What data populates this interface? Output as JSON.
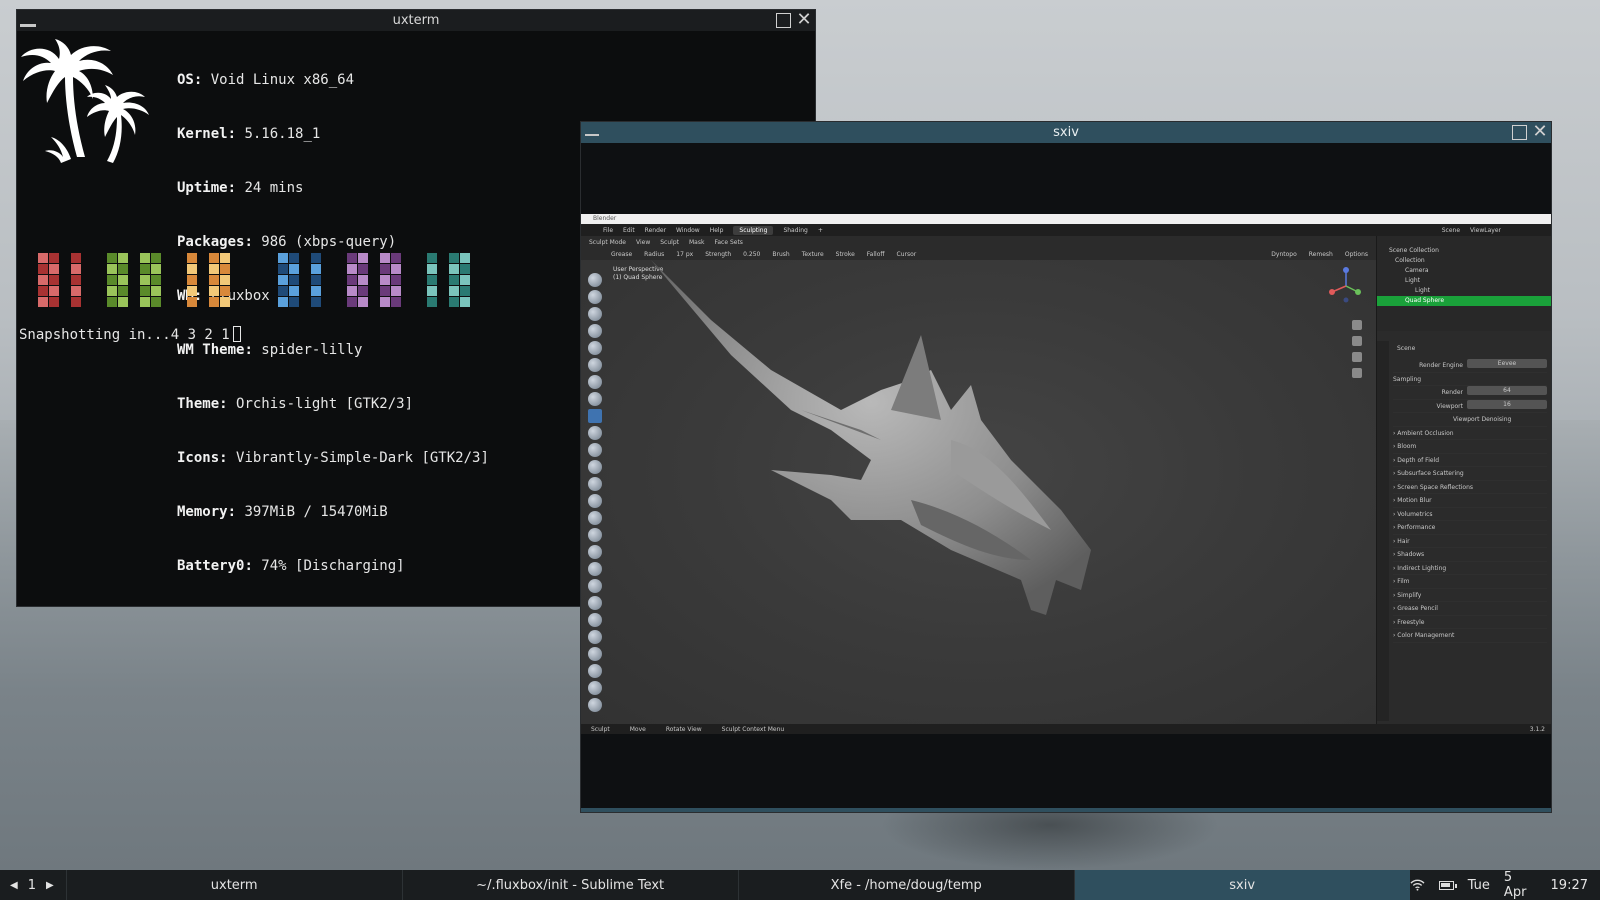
{
  "colors": {
    "accent_teal": "#2f4f5e",
    "terminal_bg": "#0c0d0e",
    "outliner_selected": "#1aa13a"
  },
  "uxterm": {
    "title": "uxterm",
    "info": [
      {
        "key": "OS",
        "value": "Void Linux x86_64"
      },
      {
        "key": "Kernel",
        "value": "5.16.18_1"
      },
      {
        "key": "Uptime",
        "value": "24 mins"
      },
      {
        "key": "Packages",
        "value": "986 (xbps-query)"
      },
      {
        "key": "WM",
        "value": "Fluxbox"
      },
      {
        "key": "WM Theme",
        "value": "spider-lilly"
      },
      {
        "key": "Theme",
        "value": "Orchis-light [GTK2/3]"
      },
      {
        "key": "Icons",
        "value": "Vibrantly-Simple-Dark [GTK2/3]"
      },
      {
        "key": "Memory",
        "value": "397MiB / 15470MiB"
      },
      {
        "key": "Battery0",
        "value": "74% [Discharging]"
      }
    ],
    "swatch_colors": [
      [
        "#a83232",
        "#d86a6a"
      ],
      [
        "#5a8a2a",
        "#9ac45a"
      ],
      [
        "#d8883a",
        "#f2c878"
      ],
      [
        "#1f4a78",
        "#5aa0dc"
      ],
      [
        "#6a3a7a",
        "#b88ac8"
      ],
      [
        "#2a7a72",
        "#7ac4bc"
      ]
    ],
    "prompt": "Snapshotting in...4 3 2 1"
  },
  "sxiv": {
    "title": "sxiv",
    "blender": {
      "os_title": "Blender",
      "menu": [
        "File",
        "Edit",
        "Render",
        "Window",
        "Help"
      ],
      "workspace_tabs": [
        "Sculpting",
        "Shading",
        "+"
      ],
      "scene": "Scene",
      "view_layer": "ViewLayer",
      "header": [
        "Sculpt Mode",
        "View",
        "Sculpt",
        "Mask",
        "Face Sets"
      ],
      "tool_settings": [
        "Radius",
        "17 px",
        "Strength",
        "0.250",
        "Brush",
        "Texture",
        "Stroke",
        "Falloff",
        "Cursor"
      ],
      "brush_name": "Grease",
      "viewport_label_1": "User Perspective",
      "viewport_label_2": "(1) Quad Sphere",
      "right_header": [
        "Dyntopo",
        "Remesh",
        "Options"
      ],
      "outliner": [
        {
          "label": "Scene Collection",
          "selected": false
        },
        {
          "label": "Collection",
          "selected": false
        },
        {
          "label": "Camera",
          "selected": false
        },
        {
          "label": "Light",
          "selected": false
        },
        {
          "label": "Light",
          "selected": false
        },
        {
          "label": "Quad Sphere",
          "selected": true
        }
      ],
      "props_header": "Scene",
      "render_engine_label": "Render Engine",
      "render_engine_value": "Eevee",
      "sampling": "Sampling",
      "render_samples_label": "Render",
      "render_samples_value": "64",
      "viewport_samples_label": "Viewport",
      "viewport_samples_value": "16",
      "viewport_denoising": "Viewport Denoising",
      "panels": [
        "Ambient Occlusion",
        "Bloom",
        "Depth of Field",
        "Subsurface Scattering",
        "Screen Space Reflections",
        "Motion Blur",
        "Volumetrics",
        "Performance",
        "Hair",
        "Shadows",
        "Indirect Lighting",
        "Film",
        "Simplify",
        "Grease Pencil",
        "Freestyle",
        "Color Management"
      ],
      "status": [
        "Sculpt",
        "Move",
        "Rotate View",
        "Sculpt Context Menu"
      ],
      "version": "3.1.2"
    }
  },
  "taskbar": {
    "workspace": "1",
    "tasks": [
      {
        "label": "uxterm",
        "active": false
      },
      {
        "label": "~/.fluxbox/init - Sublime Text",
        "active": false
      },
      {
        "label": "Xfe - /home/doug/temp",
        "active": false
      },
      {
        "label": "sxiv",
        "active": true
      }
    ],
    "battery_level": 0.74,
    "day": "Tue",
    "date": "5 Apr",
    "time": "19:27"
  }
}
